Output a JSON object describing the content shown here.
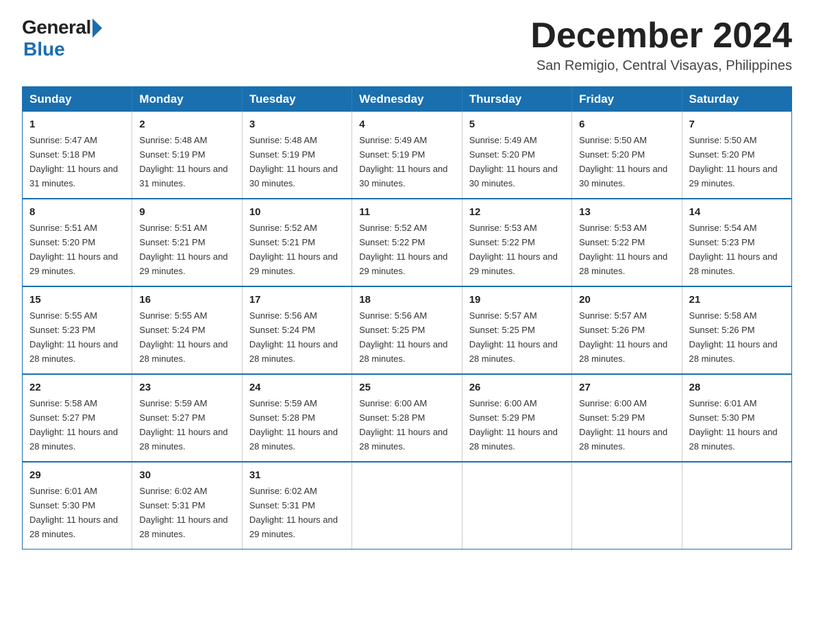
{
  "logo": {
    "general": "General",
    "blue": "Blue"
  },
  "title": {
    "month": "December 2024",
    "location": "San Remigio, Central Visayas, Philippines"
  },
  "weekdays": [
    "Sunday",
    "Monday",
    "Tuesday",
    "Wednesday",
    "Thursday",
    "Friday",
    "Saturday"
  ],
  "weeks": [
    [
      {
        "day": "1",
        "sunrise": "5:47 AM",
        "sunset": "5:18 PM",
        "daylight": "11 hours and 31 minutes."
      },
      {
        "day": "2",
        "sunrise": "5:48 AM",
        "sunset": "5:19 PM",
        "daylight": "11 hours and 31 minutes."
      },
      {
        "day": "3",
        "sunrise": "5:48 AM",
        "sunset": "5:19 PM",
        "daylight": "11 hours and 30 minutes."
      },
      {
        "day": "4",
        "sunrise": "5:49 AM",
        "sunset": "5:19 PM",
        "daylight": "11 hours and 30 minutes."
      },
      {
        "day": "5",
        "sunrise": "5:49 AM",
        "sunset": "5:20 PM",
        "daylight": "11 hours and 30 minutes."
      },
      {
        "day": "6",
        "sunrise": "5:50 AM",
        "sunset": "5:20 PM",
        "daylight": "11 hours and 30 minutes."
      },
      {
        "day": "7",
        "sunrise": "5:50 AM",
        "sunset": "5:20 PM",
        "daylight": "11 hours and 29 minutes."
      }
    ],
    [
      {
        "day": "8",
        "sunrise": "5:51 AM",
        "sunset": "5:20 PM",
        "daylight": "11 hours and 29 minutes."
      },
      {
        "day": "9",
        "sunrise": "5:51 AM",
        "sunset": "5:21 PM",
        "daylight": "11 hours and 29 minutes."
      },
      {
        "day": "10",
        "sunrise": "5:52 AM",
        "sunset": "5:21 PM",
        "daylight": "11 hours and 29 minutes."
      },
      {
        "day": "11",
        "sunrise": "5:52 AM",
        "sunset": "5:22 PM",
        "daylight": "11 hours and 29 minutes."
      },
      {
        "day": "12",
        "sunrise": "5:53 AM",
        "sunset": "5:22 PM",
        "daylight": "11 hours and 29 minutes."
      },
      {
        "day": "13",
        "sunrise": "5:53 AM",
        "sunset": "5:22 PM",
        "daylight": "11 hours and 28 minutes."
      },
      {
        "day": "14",
        "sunrise": "5:54 AM",
        "sunset": "5:23 PM",
        "daylight": "11 hours and 28 minutes."
      }
    ],
    [
      {
        "day": "15",
        "sunrise": "5:55 AM",
        "sunset": "5:23 PM",
        "daylight": "11 hours and 28 minutes."
      },
      {
        "day": "16",
        "sunrise": "5:55 AM",
        "sunset": "5:24 PM",
        "daylight": "11 hours and 28 minutes."
      },
      {
        "day": "17",
        "sunrise": "5:56 AM",
        "sunset": "5:24 PM",
        "daylight": "11 hours and 28 minutes."
      },
      {
        "day": "18",
        "sunrise": "5:56 AM",
        "sunset": "5:25 PM",
        "daylight": "11 hours and 28 minutes."
      },
      {
        "day": "19",
        "sunrise": "5:57 AM",
        "sunset": "5:25 PM",
        "daylight": "11 hours and 28 minutes."
      },
      {
        "day": "20",
        "sunrise": "5:57 AM",
        "sunset": "5:26 PM",
        "daylight": "11 hours and 28 minutes."
      },
      {
        "day": "21",
        "sunrise": "5:58 AM",
        "sunset": "5:26 PM",
        "daylight": "11 hours and 28 minutes."
      }
    ],
    [
      {
        "day": "22",
        "sunrise": "5:58 AM",
        "sunset": "5:27 PM",
        "daylight": "11 hours and 28 minutes."
      },
      {
        "day": "23",
        "sunrise": "5:59 AM",
        "sunset": "5:27 PM",
        "daylight": "11 hours and 28 minutes."
      },
      {
        "day": "24",
        "sunrise": "5:59 AM",
        "sunset": "5:28 PM",
        "daylight": "11 hours and 28 minutes."
      },
      {
        "day": "25",
        "sunrise": "6:00 AM",
        "sunset": "5:28 PM",
        "daylight": "11 hours and 28 minutes."
      },
      {
        "day": "26",
        "sunrise": "6:00 AM",
        "sunset": "5:29 PM",
        "daylight": "11 hours and 28 minutes."
      },
      {
        "day": "27",
        "sunrise": "6:00 AM",
        "sunset": "5:29 PM",
        "daylight": "11 hours and 28 minutes."
      },
      {
        "day": "28",
        "sunrise": "6:01 AM",
        "sunset": "5:30 PM",
        "daylight": "11 hours and 28 minutes."
      }
    ],
    [
      {
        "day": "29",
        "sunrise": "6:01 AM",
        "sunset": "5:30 PM",
        "daylight": "11 hours and 28 minutes."
      },
      {
        "day": "30",
        "sunrise": "6:02 AM",
        "sunset": "5:31 PM",
        "daylight": "11 hours and 28 minutes."
      },
      {
        "day": "31",
        "sunrise": "6:02 AM",
        "sunset": "5:31 PM",
        "daylight": "11 hours and 29 minutes."
      },
      null,
      null,
      null,
      null
    ]
  ]
}
